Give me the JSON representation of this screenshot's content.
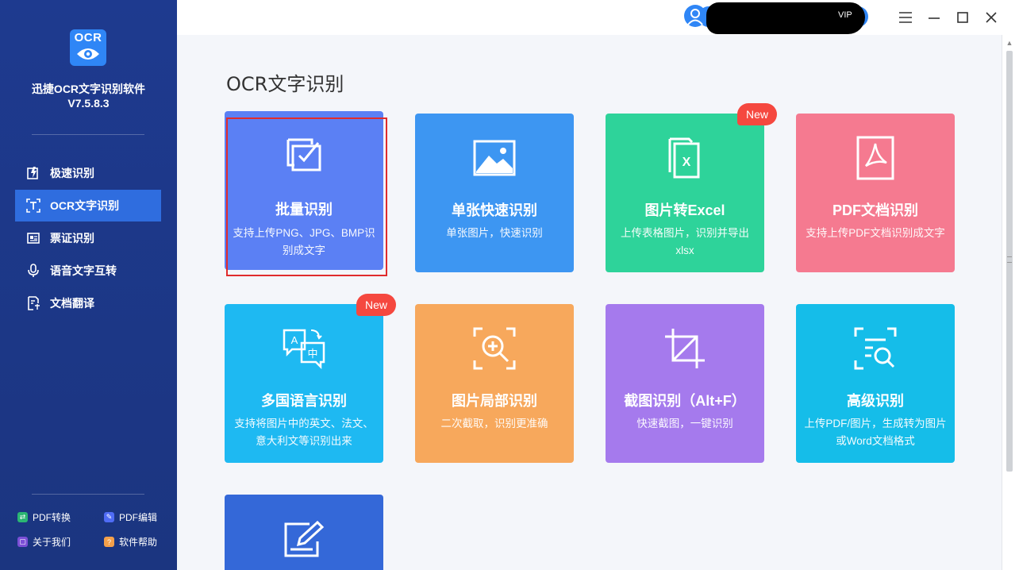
{
  "sidebar": {
    "logo_text": "OCR",
    "app_name": "迅捷OCR文字识别软件",
    "app_version": "V7.5.8.3",
    "items": [
      {
        "label": "极速识别",
        "icon": "lightning-doc-icon"
      },
      {
        "label": "OCR文字识别",
        "icon": "text-scan-icon",
        "active": true
      },
      {
        "label": "票证识别",
        "icon": "ticket-icon"
      },
      {
        "label": "语音文字互转",
        "icon": "microphone-icon"
      },
      {
        "label": "文档翻译",
        "icon": "doc-translate-icon"
      }
    ],
    "footer_links": [
      {
        "label": "PDF转换",
        "icon": "pdf-convert-icon",
        "color": "#2bb673"
      },
      {
        "label": "PDF编辑",
        "icon": "pdf-edit-icon",
        "color": "#4f6cf5"
      },
      {
        "label": "关于我们",
        "icon": "about-icon",
        "color": "#7b4fd6"
      },
      {
        "label": "软件帮助",
        "icon": "help-icon",
        "color": "#f5a04a"
      }
    ]
  },
  "topbar": {
    "user_vip": "VIP",
    "window_controls": [
      "menu-icon",
      "minimize-icon",
      "maximize-icon",
      "close-icon"
    ]
  },
  "main": {
    "title": "OCR文字识别",
    "cards": [
      {
        "title": "批量识别",
        "desc": "支持上传PNG、JPG、BMP识别成文字",
        "color": "#5b80f4",
        "icon": "batch-check-icon",
        "selected": true
      },
      {
        "title": "单张快速识别",
        "desc": "单张图片，快速识别",
        "color": "#3d96f2",
        "icon": "image-icon"
      },
      {
        "title": "图片转Excel",
        "desc": "上传表格图片，识别并导出xlsx",
        "color": "#2ed39a",
        "icon": "excel-icon",
        "badge": "New"
      },
      {
        "title": "PDF文档识别",
        "desc": "支持上传PDF文档识别成文字",
        "color": "#f57a90",
        "icon": "pdf-icon"
      },
      {
        "title": "多国语言识别",
        "desc": "支持将图片中的英文、法文、意大利文等识别出来",
        "color": "#1eb9f2",
        "icon": "language-icon",
        "badge": "New"
      },
      {
        "title": "图片局部识别",
        "desc": "二次截取，识别更准确",
        "color": "#f7a85c",
        "icon": "zoom-scan-icon"
      },
      {
        "title": "截图识别（Alt+F）",
        "desc": "快速截图，一键识别",
        "color": "#a57aed",
        "icon": "crop-icon"
      },
      {
        "title": "高级识别",
        "desc": "上传PDF/图片，生成转为图片或Word文档格式",
        "color": "#15bde9",
        "icon": "advanced-scan-icon"
      },
      {
        "title": "",
        "desc": "",
        "color": "#3468d8",
        "icon": "edit-doc-icon"
      }
    ]
  }
}
